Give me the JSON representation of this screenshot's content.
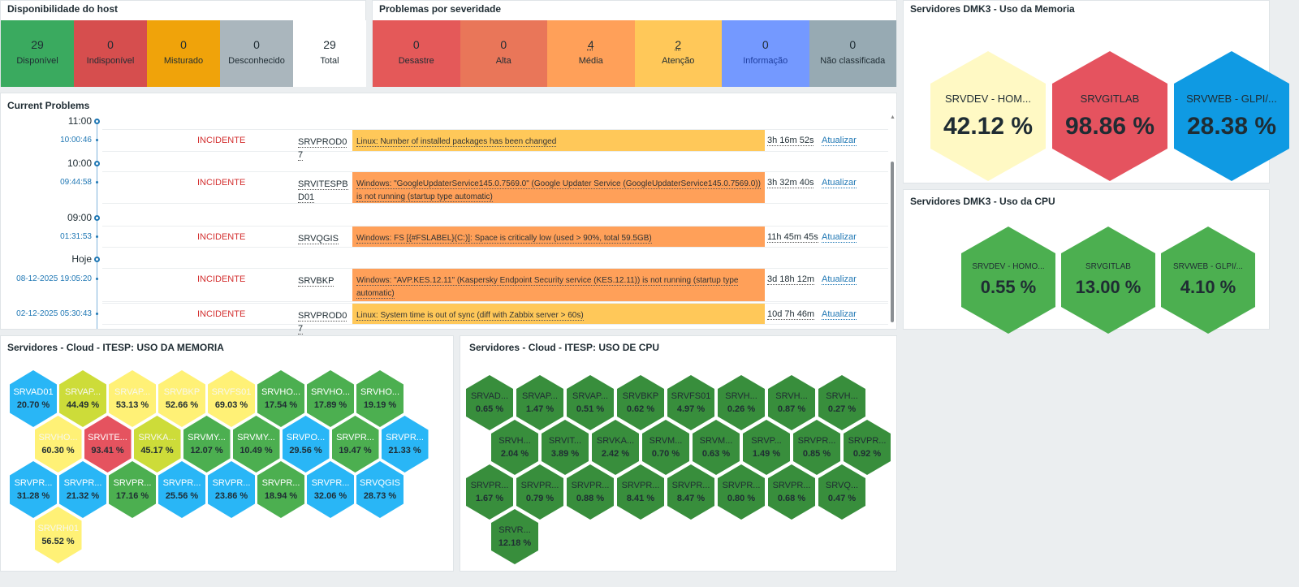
{
  "host_availability": {
    "title": "Disponibilidade do host",
    "cells": [
      {
        "value": "29",
        "label": "Disponível",
        "color": "#3aaa5f"
      },
      {
        "value": "0",
        "label": "Indisponível",
        "color": "#d64e4e"
      },
      {
        "value": "0",
        "label": "Misturado",
        "color": "#f0a30a"
      },
      {
        "value": "0",
        "label": "Desconhecido",
        "color": "#aab6bd"
      },
      {
        "value": "29",
        "label": "Total",
        "color": "#ffffff"
      }
    ]
  },
  "severity": {
    "title": "Problemas por severidade",
    "cells": [
      {
        "value": "0",
        "label": "Desastre",
        "color": "#e45959"
      },
      {
        "value": "0",
        "label": "Alta",
        "color": "#e97659"
      },
      {
        "value": "4",
        "label": "Média",
        "color": "#ffa059"
      },
      {
        "value": "2",
        "label": "Atenção",
        "color": "#ffc859"
      },
      {
        "value": "0",
        "label": "Informação",
        "color": "#7499ff"
      },
      {
        "value": "0",
        "label": "Não classificada",
        "color": "#97aab3"
      }
    ]
  },
  "problems": {
    "title": "Current Problems",
    "markers": [
      "11:00",
      "10:00",
      "09:00",
      "Hoje"
    ],
    "rows": [
      {
        "time": "10:00:46",
        "status": "INCIDENTE",
        "host": "SRVPROD07",
        "problem": "Linux: Number of installed packages has been changed",
        "duration": "3h 16m 52s",
        "action": "Atualizar",
        "color": "#ffc859"
      },
      {
        "time": "09:44:58",
        "status": "INCIDENTE",
        "host": "SRVITESPBD01",
        "problem": "Windows: \"GoogleUpdaterService145.0.7569.0\" (Google Updater Service (GoogleUpdaterService145.0.7569.0)) is not running (startup type automatic)",
        "duration": "3h 32m 40s",
        "action": "Atualizar",
        "color": "#ffa059"
      },
      {
        "time": "01:31:53",
        "status": "INCIDENTE",
        "host": "SRVQGIS",
        "problem": "Windows: FS [{#FSLABEL}(C:)]: Space is critically low (used > 90%, total 59.5GB)",
        "duration": "11h 45m 45s",
        "action": "Atualizar",
        "color": "#ffa059"
      },
      {
        "time": "08-12-2025 19:05:20",
        "status": "INCIDENTE",
        "host": "SRVBKP",
        "problem": "Windows: \"AVP.KES.12.11\" (Kaspersky Endpoint Security service (KES.12.11)) is not running (startup type automatic)",
        "duration": "3d 18h 12m",
        "action": "Atualizar",
        "color": "#ffa059"
      },
      {
        "time": "02-12-2025 05:30:43",
        "status": "INCIDENTE",
        "host": "SRVPROD07",
        "problem": "Linux: System time is out of sync (diff with Zabbix server > 60s)",
        "duration": "10d 7h 46m",
        "action": "Atualizar",
        "color": "#ffc859"
      }
    ]
  },
  "dmk3_memory": {
    "title": "Servidores DMK3 - Uso da Memoria",
    "items": [
      {
        "name": "SRVDEV - HOM...",
        "value": "42.12 %",
        "color": "#fff9c4"
      },
      {
        "name": "SRVGITLAB",
        "value": "98.86 %",
        "color": "#e5535f"
      },
      {
        "name": "SRVWEB - GLPI/...",
        "value": "28.38 %",
        "color": "#0f9ae3"
      }
    ]
  },
  "dmk3_cpu": {
    "title": "Servidores DMK3 - Uso da CPU",
    "items": [
      {
        "name": "SRVDEV - HOMO...",
        "value": "0.55 %",
        "color": "#4caf50"
      },
      {
        "name": "SRVGITLAB",
        "value": "13.00 %",
        "color": "#4caf50"
      },
      {
        "name": "SRVWEB - GLPI/...",
        "value": "4.10 %",
        "color": "#4caf50"
      }
    ]
  },
  "cloud_memory": {
    "title": "Servidores - Cloud - ITESP: USO DA MEMORIA",
    "items": [
      {
        "name": "SRVAD01",
        "value": "20.70 %",
        "color": "#29b6f6"
      },
      {
        "name": "SRVAP...",
        "value": "44.49 %",
        "color": "#cddc39"
      },
      {
        "name": "SRVAP...",
        "value": "53.13 %",
        "color": "#fff176"
      },
      {
        "name": "SRVBKP",
        "value": "52.66 %",
        "color": "#fff176"
      },
      {
        "name": "SRVFS01",
        "value": "69.03 %",
        "color": "#fff176"
      },
      {
        "name": "SRVHO...",
        "value": "17.54 %",
        "color": "#4caf50"
      },
      {
        "name": "SRVHO...",
        "value": "17.89 %",
        "color": "#4caf50"
      },
      {
        "name": "SRVHO...",
        "value": "19.19 %",
        "color": "#4caf50"
      },
      {
        "name": "SRVHO...",
        "value": "60.30 %",
        "color": "#fff176"
      },
      {
        "name": "SRVITE...",
        "value": "93.41 %",
        "color": "#e5535f"
      },
      {
        "name": "SRVKA...",
        "value": "45.17 %",
        "color": "#cddc39"
      },
      {
        "name": "SRVMY...",
        "value": "12.07 %",
        "color": "#4caf50"
      },
      {
        "name": "SRVMY...",
        "value": "10.49 %",
        "color": "#4caf50"
      },
      {
        "name": "SRVPO...",
        "value": "29.56 %",
        "color": "#29b6f6"
      },
      {
        "name": "SRVPR...",
        "value": "19.47 %",
        "color": "#4caf50"
      },
      {
        "name": "SRVPR...",
        "value": "21.33 %",
        "color": "#29b6f6"
      },
      {
        "name": "SRVPR...",
        "value": "31.28 %",
        "color": "#29b6f6"
      },
      {
        "name": "SRVPR...",
        "value": "21.32 %",
        "color": "#29b6f6"
      },
      {
        "name": "SRVPR...",
        "value": "17.16 %",
        "color": "#4caf50"
      },
      {
        "name": "SRVPR...",
        "value": "25.56 %",
        "color": "#29b6f6"
      },
      {
        "name": "SRVPR...",
        "value": "23.86 %",
        "color": "#29b6f6"
      },
      {
        "name": "SRVPR...",
        "value": "18.94 %",
        "color": "#4caf50"
      },
      {
        "name": "SRVPR...",
        "value": "32.06 %",
        "color": "#29b6f6"
      },
      {
        "name": "SRVQGIS",
        "value": "28.73 %",
        "color": "#29b6f6"
      },
      {
        "name": "SRVRH01",
        "value": "56.52 %",
        "color": "#fff176"
      }
    ]
  },
  "cloud_cpu": {
    "title": "Servidores - Cloud - ITESP: USO DE CPU",
    "color": "#388e3c",
    "items": [
      {
        "name": "SRVAD...",
        "value": "0.65 %"
      },
      {
        "name": "SRVAP...",
        "value": "1.47 %"
      },
      {
        "name": "SRVAP...",
        "value": "0.51 %"
      },
      {
        "name": "SRVBKP",
        "value": "0.62 %"
      },
      {
        "name": "SRVFS01",
        "value": "4.97 %"
      },
      {
        "name": "SRVH...",
        "value": "0.26 %"
      },
      {
        "name": "SRVH...",
        "value": "0.87 %"
      },
      {
        "name": "SRVH...",
        "value": "0.27 %"
      },
      {
        "name": "SRVH...",
        "value": "2.04 %"
      },
      {
        "name": "SRVIT...",
        "value": "3.89 %"
      },
      {
        "name": "SRVKA...",
        "value": "2.42 %"
      },
      {
        "name": "SRVM...",
        "value": "0.70 %"
      },
      {
        "name": "SRVM...",
        "value": "0.63 %"
      },
      {
        "name": "SRVP...",
        "value": "1.49 %"
      },
      {
        "name": "SRVPR...",
        "value": "0.85 %"
      },
      {
        "name": "SRVPR...",
        "value": "0.92 %"
      },
      {
        "name": "SRVPR...",
        "value": "1.67 %"
      },
      {
        "name": "SRVPR...",
        "value": "0.79 %"
      },
      {
        "name": "SRVPR...",
        "value": "0.88 %"
      },
      {
        "name": "SRVPR...",
        "value": "8.41 %"
      },
      {
        "name": "SRVPR...",
        "value": "8.47 %"
      },
      {
        "name": "SRVPR...",
        "value": "0.80 %"
      },
      {
        "name": "SRVPR...",
        "value": "0.68 %"
      },
      {
        "name": "SRVQ...",
        "value": "0.47 %"
      },
      {
        "name": "SRVR...",
        "value": "12.18 %"
      }
    ]
  }
}
